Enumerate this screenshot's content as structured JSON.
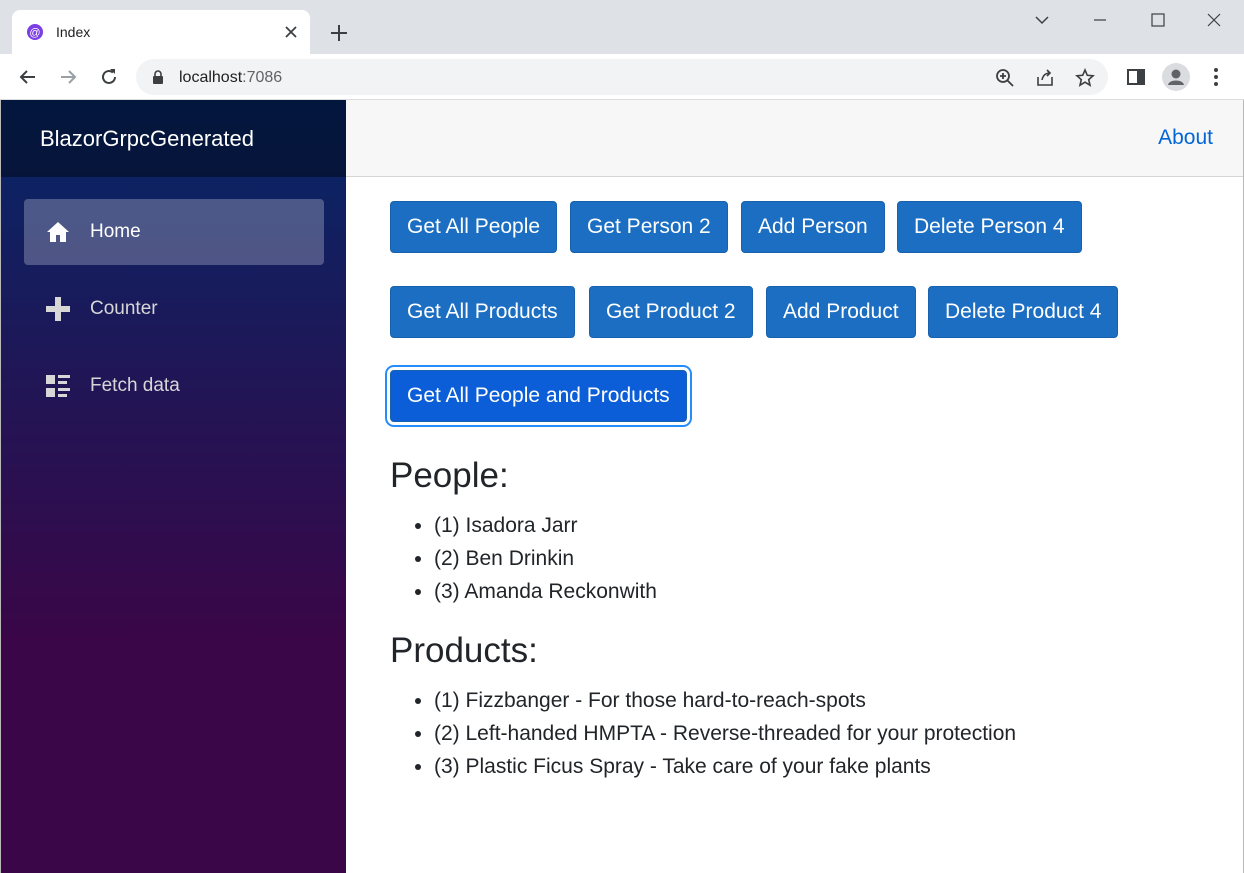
{
  "browser": {
    "tab_title": "Index",
    "url_host": "localhost",
    "url_port": ":7086"
  },
  "app": {
    "brand": "BlazorGrpcGenerated",
    "nav": [
      {
        "label": "Home",
        "icon": "home-icon",
        "active": true
      },
      {
        "label": "Counter",
        "icon": "plus-icon",
        "active": false
      },
      {
        "label": "Fetch data",
        "icon": "list-icon",
        "active": false
      }
    ],
    "top_link": "About",
    "buttons": {
      "get_all_people": "Get All People",
      "get_person_2": "Get Person 2",
      "add_person": "Add Person",
      "delete_person_4": "Delete Person 4",
      "get_all_products": "Get All Products",
      "get_product_2": "Get Product 2",
      "add_product": "Add Product",
      "delete_product_4": "Delete Product 4",
      "get_all_people_and_products": "Get All People and Products"
    },
    "people_heading": "People:",
    "people": [
      "(1) Isadora Jarr",
      "(2) Ben Drinkin",
      "(3) Amanda Reckonwith"
    ],
    "products_heading": "Products:",
    "products": [
      "(1) Fizzbanger - For those hard-to-reach-spots",
      "(2) Left-handed HMPTA - Reverse-threaded for your protection",
      "(3) Plastic Ficus Spray - Take care of your fake plants"
    ]
  },
  "colors": {
    "primary_button": "#1b6ec2",
    "link": "#0366d6",
    "sidebar_top": "#052767",
    "sidebar_bottom": "#3a0647"
  }
}
